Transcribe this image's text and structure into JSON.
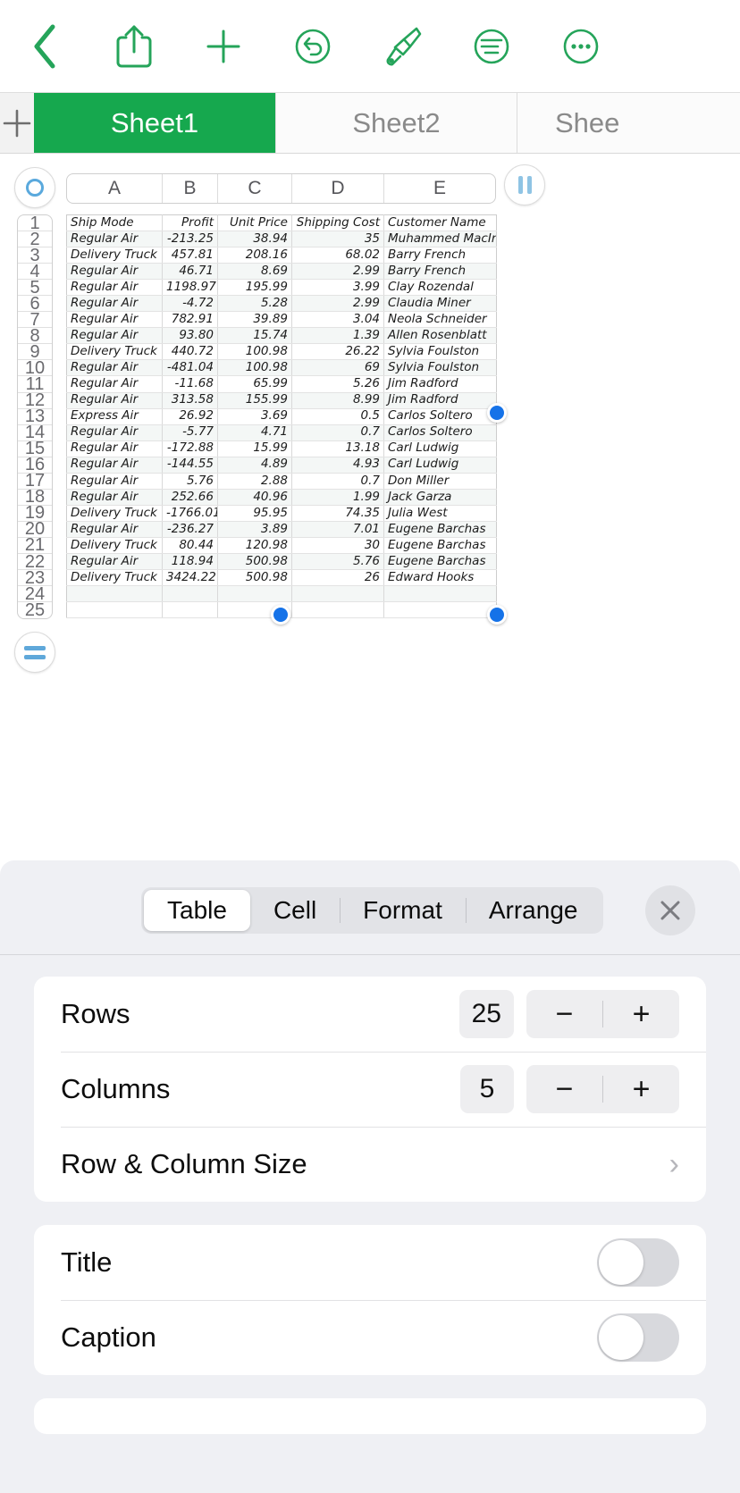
{
  "toolbar": {
    "items": [
      {
        "name": "back-icon",
        "label": "Back"
      },
      {
        "name": "share-icon",
        "label": "Share"
      },
      {
        "name": "insert-icon",
        "label": "Insert"
      },
      {
        "name": "undo-icon",
        "label": "Undo"
      },
      {
        "name": "format-brush-icon",
        "label": "Format"
      },
      {
        "name": "document-options-icon",
        "label": "Document Options"
      },
      {
        "name": "more-icon",
        "label": "More"
      }
    ],
    "accent_color": "#25a45a"
  },
  "sheetbar": {
    "add_label": "+",
    "tabs": [
      {
        "label": "Sheet1",
        "active": true
      },
      {
        "label": "Sheet2",
        "active": false
      },
      {
        "label": "Shee",
        "active": false
      }
    ],
    "active_color": "#16a84e"
  },
  "grid": {
    "select_all_label": "",
    "grip_label": "",
    "formula_label": "",
    "columns": [
      "A",
      "B",
      "C",
      "D",
      "E"
    ],
    "row_numbers": [
      "1",
      "2",
      "3",
      "4",
      "5",
      "6",
      "7",
      "8",
      "9",
      "10",
      "11",
      "12",
      "13",
      "14",
      "15",
      "16",
      "17",
      "18",
      "19",
      "20",
      "21",
      "22",
      "23",
      "24",
      "25"
    ],
    "headers": [
      "Ship Mode",
      "Profit",
      "Unit Price",
      "Shipping Cost",
      "Customer Name"
    ],
    "rows": [
      [
        "Regular Air",
        "-213.25",
        "38.94",
        "35",
        "Muhammed MacIntyre"
      ],
      [
        "Delivery Truck",
        "457.81",
        "208.16",
        "68.02",
        "Barry French"
      ],
      [
        "Regular Air",
        "46.71",
        "8.69",
        "2.99",
        "Barry French"
      ],
      [
        "Regular Air",
        "1198.97",
        "195.99",
        "3.99",
        "Clay Rozendal"
      ],
      [
        "Regular Air",
        "-4.72",
        "5.28",
        "2.99",
        "Claudia Miner"
      ],
      [
        "Regular Air",
        "782.91",
        "39.89",
        "3.04",
        "Neola Schneider"
      ],
      [
        "Regular Air",
        "93.80",
        "15.74",
        "1.39",
        "Allen Rosenblatt"
      ],
      [
        "Delivery Truck",
        "440.72",
        "100.98",
        "26.22",
        "Sylvia Foulston"
      ],
      [
        "Regular Air",
        "-481.04",
        "100.98",
        "69",
        "Sylvia Foulston"
      ],
      [
        "Regular Air",
        "-11.68",
        "65.99",
        "5.26",
        "Jim Radford"
      ],
      [
        "Regular Air",
        "313.58",
        "155.99",
        "8.99",
        "Jim Radford"
      ],
      [
        "Express Air",
        "26.92",
        "3.69",
        "0.5",
        "Carlos Soltero"
      ],
      [
        "Regular Air",
        "-5.77",
        "4.71",
        "0.7",
        "Carlos Soltero"
      ],
      [
        "Regular Air",
        "-172.88",
        "15.99",
        "13.18",
        "Carl Ludwig"
      ],
      [
        "Regular Air",
        "-144.55",
        "4.89",
        "4.93",
        "Carl Ludwig"
      ],
      [
        "Regular Air",
        "5.76",
        "2.88",
        "0.7",
        "Don Miller"
      ],
      [
        "Regular Air",
        "252.66",
        "40.96",
        "1.99",
        "Jack Garza"
      ],
      [
        "Delivery Truck",
        "-1766.01",
        "95.95",
        "74.35",
        "Julia West"
      ],
      [
        "Regular Air",
        "-236.27",
        "3.89",
        "7.01",
        "Eugene Barchas"
      ],
      [
        "Delivery Truck",
        "80.44",
        "120.98",
        "30",
        "Eugene Barchas"
      ],
      [
        "Regular Air",
        "118.94",
        "500.98",
        "5.76",
        "Eugene Barchas"
      ],
      [
        "Delivery Truck",
        "3424.22",
        "500.98",
        "26",
        "Edward Hooks"
      ],
      [
        "",
        "",
        "",
        "",
        ""
      ],
      [
        "",
        "",
        "",
        "",
        ""
      ]
    ],
    "selection_handle_color": "#1572e8"
  },
  "panel": {
    "tabs": [
      {
        "label": "Table",
        "active": true
      },
      {
        "label": "Cell",
        "active": false
      },
      {
        "label": "Format",
        "active": false
      },
      {
        "label": "Arrange",
        "active": false
      }
    ],
    "close_label": "✕",
    "rows_label": "Rows",
    "rows_value": "25",
    "columns_label": "Columns",
    "columns_value": "5",
    "minus_label": "−",
    "plus_label": "+",
    "row_column_size_label": "Row & Column Size",
    "chevron_label": "›",
    "title_label": "Title",
    "title_on": false,
    "caption_label": "Caption",
    "caption_on": false
  }
}
